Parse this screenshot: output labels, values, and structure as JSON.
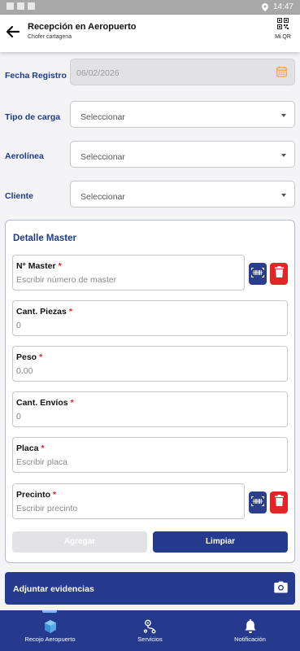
{
  "status_bar": {
    "time": "14:47"
  },
  "header": {
    "title": "Recepción en Aeropuerto",
    "subtitle": "Chofer cartagena",
    "qr_label": "Mi QR"
  },
  "form": {
    "fecha_registro": {
      "label": "Fecha Registro",
      "value": "06/02/2026"
    },
    "tipo_carga": {
      "label": "Tipo de carga",
      "value": "Seleccionar"
    },
    "aerolinea": {
      "label": "Aerolínea",
      "value": "Seleccionar"
    },
    "cliente": {
      "label": "Cliente",
      "value": "Seleccionar"
    }
  },
  "master": {
    "title": "Detalle Master",
    "fields": {
      "numero_master": {
        "label": "N° Master",
        "required": "*",
        "placeholder": "Escribir número de master"
      },
      "cant_piezas": {
        "label": "Cant. Piezas",
        "required": "*",
        "value": "0"
      },
      "peso": {
        "label": "Peso",
        "required": "*",
        "value": "0.00"
      },
      "cant_envios": {
        "label": "Cant. Envíos",
        "required": "*",
        "value": "0"
      },
      "placa": {
        "label": "Placa",
        "required": "*",
        "placeholder": "Escribir placa"
      },
      "precinto": {
        "label": "Precinto",
        "required": "*",
        "placeholder": "Escribir precinto"
      }
    },
    "agregar_label": "Agregar",
    "limpiar_label": "Limpiar"
  },
  "adjuntar": {
    "label": "Adjuntar evidencias"
  },
  "bottom_nav": {
    "items": [
      {
        "label": "Recojo Aeropuerto",
        "icon": "box-icon",
        "active": true
      },
      {
        "label": "Servicios",
        "icon": "route-icon",
        "active": false
      },
      {
        "label": "Notificación",
        "icon": "bell-icon",
        "active": false
      }
    ]
  },
  "colors": {
    "primary": "#263a8e",
    "label_blue": "#1c3a8c",
    "danger": "#e52525",
    "required": "#e02020",
    "calendar_icon": "#f2a43a",
    "nav_indicator": "#7fb8f0"
  }
}
